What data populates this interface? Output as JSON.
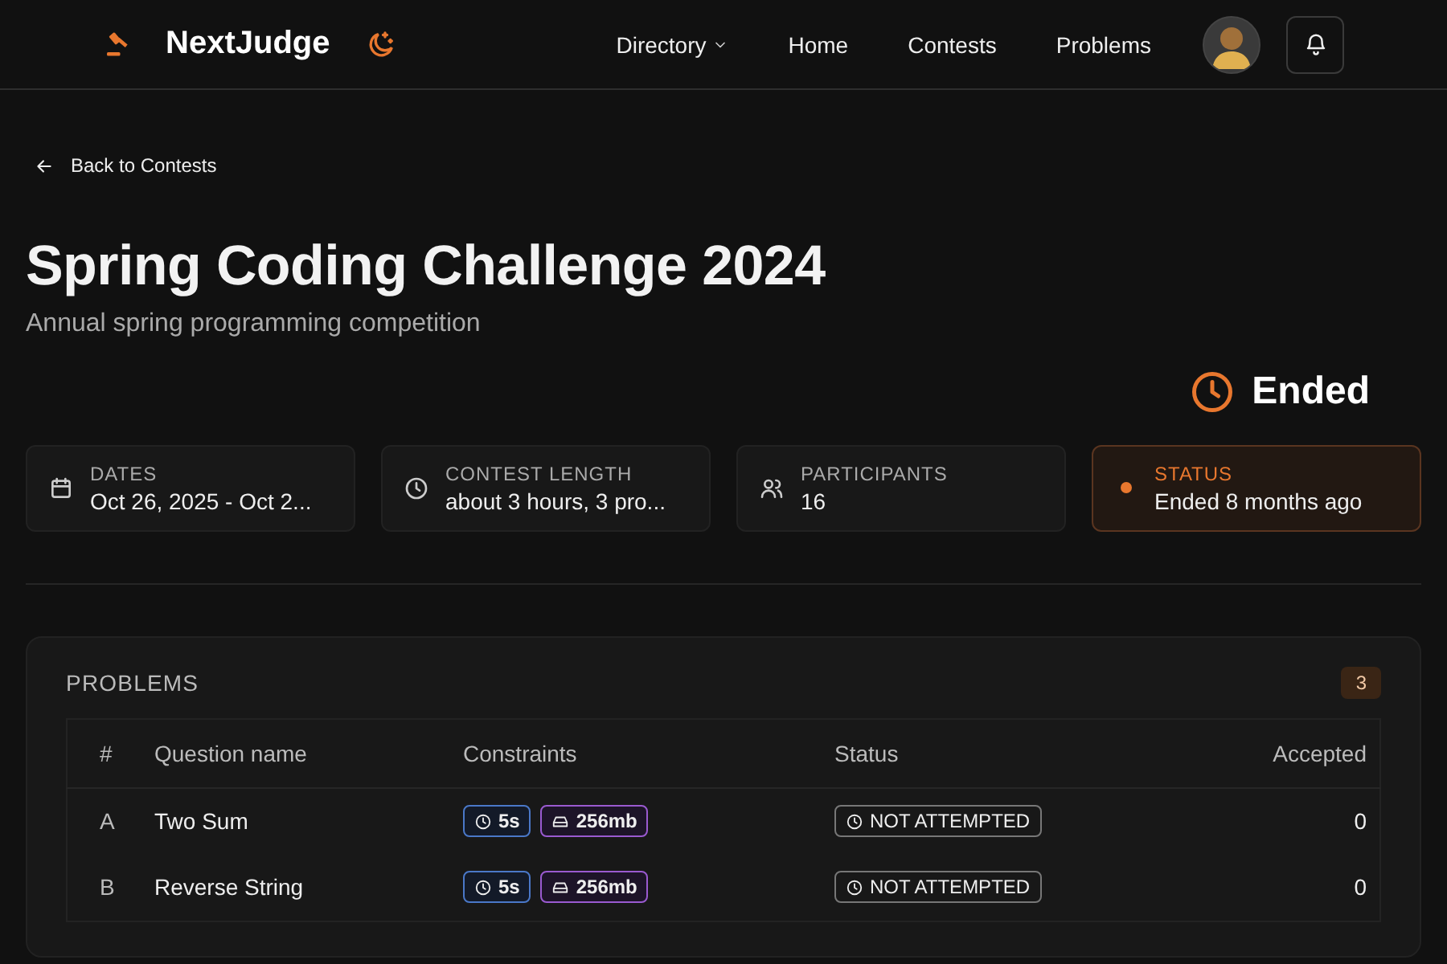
{
  "header": {
    "brand": "NextJudge",
    "nav": [
      {
        "label": "Directory",
        "dropdown": true
      },
      {
        "label": "Home",
        "dropdown": false
      },
      {
        "label": "Contests",
        "dropdown": false
      },
      {
        "label": "Problems",
        "dropdown": false
      }
    ]
  },
  "back_link": "Back to Contests",
  "contest": {
    "title": "Spring Coding Challenge 2024",
    "description": "Annual spring programming competition",
    "state": "Ended"
  },
  "info_cards": [
    {
      "kind": "info",
      "label": "DATES",
      "value": "Oct 26, 2025 - Oct 2..."
    },
    {
      "kind": "info",
      "label": "CONTEST LENGTH",
      "value": "about 3 hours, 3 pro..."
    },
    {
      "kind": "info",
      "label": "PARTICIPANTS",
      "value": "16"
    },
    {
      "kind": "status",
      "label": "STATUS",
      "value": "Ended 8 months ago"
    }
  ],
  "problems": {
    "title": "PROBLEMS",
    "count": "3",
    "columns": [
      "#",
      "Question name",
      "Constraints",
      "Status",
      "Accepted"
    ],
    "rows": [
      {
        "id": "A",
        "name": "Two Sum",
        "time": "5s",
        "memory": "256mb",
        "status": "NOT ATTEMPTED",
        "accepted": "0"
      },
      {
        "id": "B",
        "name": "Reverse String",
        "time": "5s",
        "memory": "256mb",
        "status": "NOT ATTEMPTED",
        "accepted": "0"
      }
    ]
  }
}
